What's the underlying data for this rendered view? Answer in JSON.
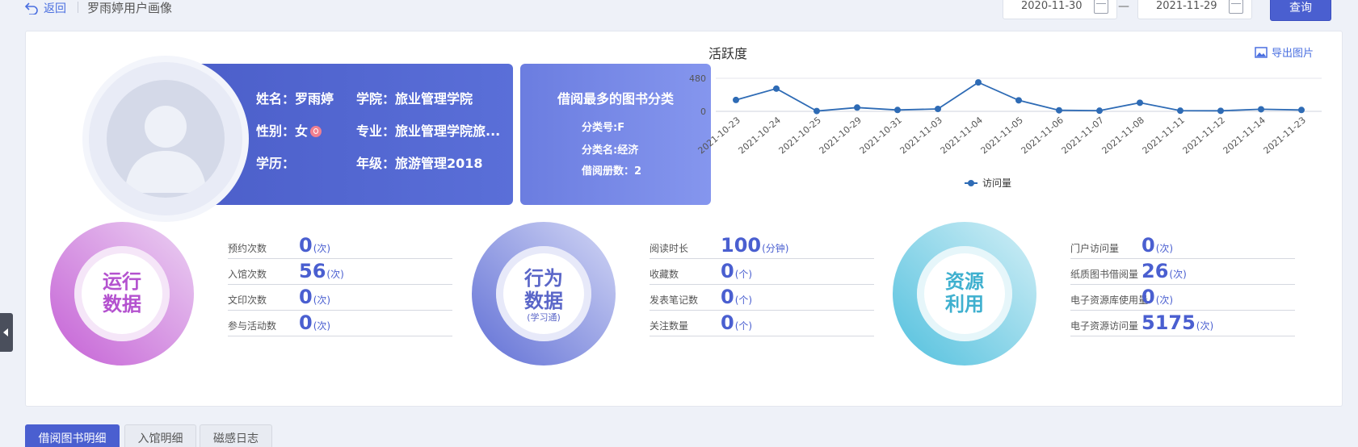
{
  "header": {
    "back_label": "返回",
    "user_title": "罗雨婷用户画像",
    "date_start": "2020-11-30",
    "date_end": "2021-11-29",
    "date_separator": "—",
    "query_label": "查询"
  },
  "profile": {
    "name": "姓名：罗雨婷",
    "gender": "性别：女",
    "education": "学历：",
    "college": "学院：旅业管理学院",
    "major": "专业：旅业管理学院旅...",
    "grade": "年级：旅游管理2018"
  },
  "category": {
    "title": "借阅最多的图书分类",
    "code": "分类号:F",
    "name": "分类名:经济",
    "count": "借阅册数：2"
  },
  "activity": {
    "title": "活跃度",
    "export_label": "导出图片"
  },
  "chart_data": {
    "type": "line",
    "title": "活跃度",
    "x": [
      "2021-10-23",
      "2021-10-24",
      "2021-10-25",
      "2021-10-29",
      "2021-10-31",
      "2021-11-03",
      "2021-11-04",
      "2021-11-05",
      "2021-11-06",
      "2021-11-07",
      "2021-11-08",
      "2021-11-11",
      "2021-11-12",
      "2021-11-14",
      "2021-11-23"
    ],
    "series": [
      {
        "name": "访问量",
        "values": [
          165,
          330,
          5,
          55,
          20,
          35,
          420,
          160,
          15,
          10,
          125,
          10,
          8,
          30,
          20
        ]
      }
    ],
    "yticks": [
      "480",
      "0"
    ],
    "ylim": [
      0,
      480
    ],
    "legend": "bottom-center",
    "color": "#2e6bb5"
  },
  "groups": [
    {
      "label_line1": "运行",
      "label_line2": "数据",
      "label_sub": "",
      "color_a": "#c86ad8",
      "color_b": "#e8c8f0",
      "text_color": "#b452cf",
      "rows": [
        {
          "label": "预约次数",
          "value": "0",
          "unit": "(次)"
        },
        {
          "label": "入馆次数",
          "value": "56",
          "unit": "(次)"
        },
        {
          "label": "文印次数",
          "value": "0",
          "unit": "(次)"
        },
        {
          "label": "参与活动数",
          "value": "0",
          "unit": "(次)"
        }
      ]
    },
    {
      "label_line1": "行为",
      "label_line2": "数据",
      "label_sub": "(学习通)",
      "color_a": "#6a78d8",
      "color_b": "#c9cef2",
      "text_color": "#5a66c8",
      "rows": [
        {
          "label": "阅读时长",
          "value": "100",
          "unit": "(分钟)"
        },
        {
          "label": "收藏数",
          "value": "0",
          "unit": "(个)"
        },
        {
          "label": "发表笔记数",
          "value": "0",
          "unit": "(个)"
        },
        {
          "label": "关注数量",
          "value": "0",
          "unit": "(个)"
        }
      ]
    },
    {
      "label_line1": "资源",
      "label_line2": "利用",
      "label_sub": "",
      "color_a": "#5cc4e0",
      "color_b": "#c8ebf4",
      "text_color": "#3fb0cf",
      "rows": [
        {
          "label": "门户访问量",
          "value": "0",
          "unit": "(次)"
        },
        {
          "label": "纸质图书借阅量",
          "value": "26",
          "unit": "(次)"
        },
        {
          "label": "电子资源库使用量",
          "value": "0",
          "unit": "(次)"
        },
        {
          "label": "电子资源访问量",
          "value": "5175",
          "unit": "(次)"
        }
      ]
    }
  ],
  "tabs": [
    {
      "label": "借阅图书明细",
      "active": true
    },
    {
      "label": "入馆明细",
      "active": false
    },
    {
      "label": "磁感日志",
      "active": false
    }
  ]
}
